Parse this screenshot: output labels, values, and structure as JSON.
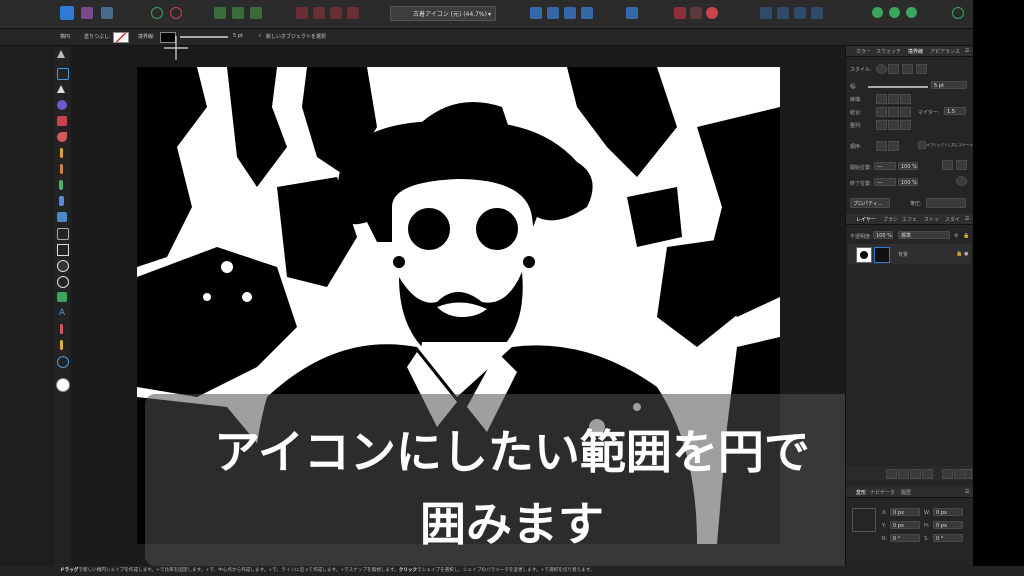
{
  "topbar": {
    "document_selector": "古着アイコン (元) (44.7%)",
    "accent_color": "#2f7bd8",
    "icons": [
      "persona-designer-icon",
      "persona-pixel-icon",
      "persona-export-icon",
      "settings-icon",
      "snapping-icon",
      "align-icon",
      "boolean-add-icon",
      "boolean-subtract-icon",
      "boolean-intersect-icon",
      "flip-icon",
      "arrange-icon",
      "snap-icon",
      "user-icon"
    ]
  },
  "context": {
    "title": "楕円",
    "fill_label": "塗りつぶし:",
    "stroke_label": "境界線:",
    "stroke_width": "5 pt",
    "new_object_label": "新しいオブジェクトを選択"
  },
  "right_panel": {
    "tabs_top": [
      "カラー",
      "スウォッチ",
      "境界線",
      "アピアランス"
    ],
    "active_top": "境界線",
    "style_label": "スタイル:",
    "width_label": "幅:",
    "width_value": "5 pt",
    "cap_label": "線端:",
    "join_label": "結合:",
    "miter_label": "マイター:",
    "miter_value": "1.5",
    "align_label": "整列:",
    "order_label": "順序:",
    "scale_label": "オブジェクトと共にスケール",
    "start_label": "開始位置:",
    "start_value": "100 %",
    "end_label": "終了位置:",
    "end_value": "100 %",
    "properties_button": "プロパティ...",
    "pressure_label": "筆圧:",
    "tabs_layers": [
      "レイヤー",
      "ブラシ",
      "エフェ",
      "ストッ",
      "スタイ"
    ],
    "active_layers": "レイヤー",
    "opacity_label": "不透明度:",
    "opacity_value": "100 %",
    "blend_mode": "標準",
    "layer_name": "背景",
    "tabs_transform": [
      "変形",
      "ナビゲータ",
      "履歴"
    ],
    "x_label": "X:",
    "x_value": "0 px",
    "y_label": "Y:",
    "y_value": "0 px",
    "w_label": "W:",
    "w_value": "0 px",
    "h_label": "H:",
    "h_value": "0 px",
    "r_label": "R:",
    "r_value": "0 °",
    "s_label": "S:",
    "s_value": "0 °"
  },
  "status": {
    "drag": "ドラッグ",
    "drag_text": "で新しい楕円シェイプを作成します。+",
    "part2": "で比率を固定します。+",
    "part3": "で、中心点から作成します。+",
    "part4": "で、ラインに沿って作成します。+",
    "part5": "でスナップを無視します。",
    "click": "クリック",
    "part6": "でシェイプを選択し、シェイプのパラメータを変更します。+",
    "part7": "で選択を切り替えます。"
  },
  "caption": {
    "line1": "アイコンにしたい範囲を円で",
    "line2": "囲みます"
  }
}
